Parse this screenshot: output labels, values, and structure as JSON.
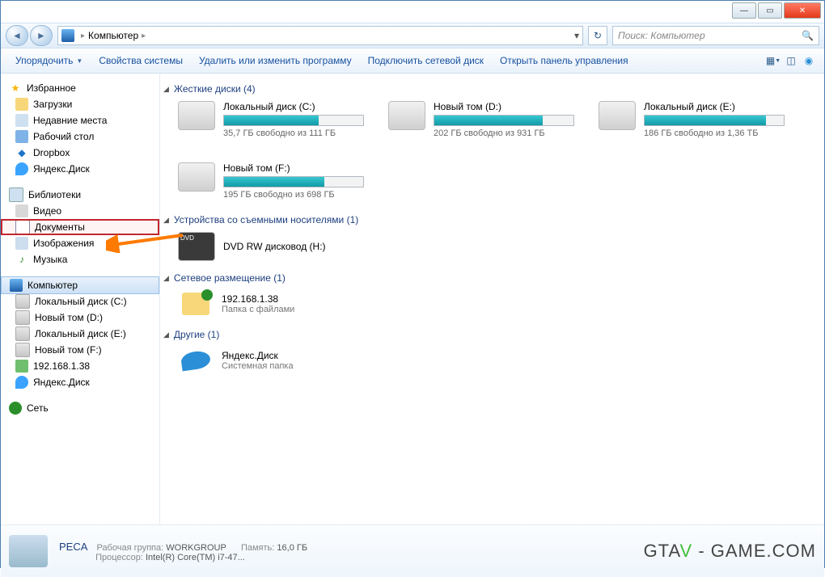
{
  "breadcrumb": {
    "location": "Компьютер"
  },
  "search": {
    "placeholder": "Поиск: Компьютер"
  },
  "toolbar": {
    "organize": "Упорядочить",
    "system_props": "Свойства системы",
    "uninstall": "Удалить или изменить программу",
    "map_drive": "Подключить сетевой диск",
    "control_panel": "Открыть панель управления"
  },
  "nav": {
    "favorites": {
      "label": "Избранное",
      "items": [
        {
          "label": "Загрузки"
        },
        {
          "label": "Недавние места"
        },
        {
          "label": "Рабочий стол"
        },
        {
          "label": "Dropbox"
        },
        {
          "label": "Яндекс.Диск"
        }
      ]
    },
    "libraries": {
      "label": "Библиотеки",
      "items": [
        {
          "label": "Видео"
        },
        {
          "label": "Документы"
        },
        {
          "label": "Изображения"
        },
        {
          "label": "Музыка"
        }
      ]
    },
    "computer": {
      "label": "Компьютер",
      "items": [
        {
          "label": "Локальный диск (C:)"
        },
        {
          "label": "Новый том (D:)"
        },
        {
          "label": "Локальный диск (E:)"
        },
        {
          "label": "Новый том (F:)"
        },
        {
          "label": "192.168.1.38"
        },
        {
          "label": "Яндекс.Диск"
        }
      ]
    },
    "network": {
      "label": "Сеть"
    }
  },
  "sections": {
    "hdd": {
      "title": "Жесткие диски (4)",
      "drives": [
        {
          "name": "Локальный диск (C:)",
          "free_text": "35,7 ГБ свободно из 111 ГБ",
          "fill_pct": 68
        },
        {
          "name": "Новый том (D:)",
          "free_text": "202 ГБ свободно из 931 ГБ",
          "fill_pct": 78
        },
        {
          "name": "Локальный диск (E:)",
          "free_text": "186 ГБ свободно из 1,36 ТБ",
          "fill_pct": 87
        },
        {
          "name": "Новый том (F:)",
          "free_text": "195 ГБ свободно из 698 ГБ",
          "fill_pct": 72
        }
      ]
    },
    "removable": {
      "title": "Устройства со съемными носителями (1)",
      "items": [
        {
          "name": "DVD RW дисковод (H:)"
        }
      ]
    },
    "netloc": {
      "title": "Сетевое размещение (1)",
      "items": [
        {
          "name": "192.168.1.38",
          "sub": "Папка с файлами"
        }
      ]
    },
    "other": {
      "title": "Другие (1)",
      "items": [
        {
          "name": "Яндекс.Диск",
          "sub": "Системная папка"
        }
      ]
    }
  },
  "status": {
    "name": "PECA",
    "workgroup_label": "Рабочая группа:",
    "workgroup": "WORKGROUP",
    "memory_label": "Память:",
    "memory": "16,0 ГБ",
    "cpu_label": "Процессор:",
    "cpu": "Intel(R) Core(TM) i7-47..."
  },
  "watermark": "GTA - GAME.COM"
}
